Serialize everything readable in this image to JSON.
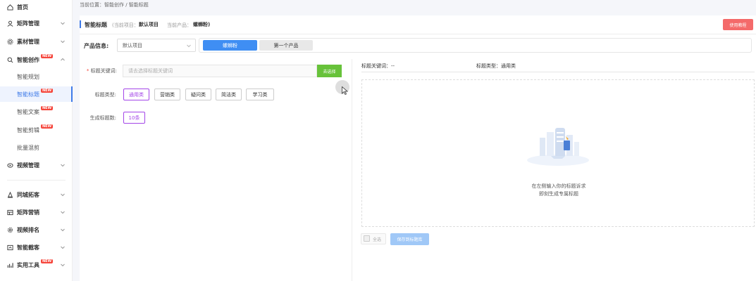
{
  "sidebar": {
    "items": [
      {
        "label": "首页",
        "icon": "home-icon"
      },
      {
        "label": "矩阵管理",
        "icon": "user-icon"
      },
      {
        "label": "素材管理",
        "icon": "gear-icon"
      },
      {
        "label": "智能创作",
        "icon": "search-icon",
        "badge": "NEW"
      },
      {
        "label": "视频管理",
        "icon": "video-icon"
      },
      {
        "label": "同城拓客",
        "icon": "person-icon"
      },
      {
        "label": "矩阵营销",
        "icon": "grid-icon"
      },
      {
        "label": "视频排名",
        "icon": "gear-small-icon"
      },
      {
        "label": "智能截客",
        "icon": "capture-icon"
      },
      {
        "label": "实用工具",
        "icon": "chart-icon",
        "badge": "NEW"
      }
    ],
    "sub_items": [
      {
        "label": "智能规划"
      },
      {
        "label": "智能标题",
        "badge": "NEW"
      },
      {
        "label": "智能文案",
        "badge": "NEW"
      },
      {
        "label": "智能剪辑",
        "badge": "NEW"
      },
      {
        "label": "批量混剪"
      }
    ]
  },
  "breadcrumb": "当前位置：智能创作 / 智能标题",
  "header": {
    "title": "智能标题",
    "project_label": "(当前项目：",
    "project_value": "默认项目",
    "product_label": "当前产品：",
    "product_value": "螺蛳粉)",
    "tutorial_button": "使用教程"
  },
  "product_info": {
    "label": "产品信息:",
    "project_select": "默认项目",
    "tabs": [
      "螺蛳粉",
      "第一个产品"
    ]
  },
  "form": {
    "keyword_label": "标题关键词:",
    "keyword_required": "*",
    "keyword_placeholder": "请去选择标题关键词",
    "keyword_button": "去选择",
    "type_label": "标题类型:",
    "types": [
      "通用类",
      "营销类",
      "疑问类",
      "简洁类",
      "学习类"
    ],
    "count_label": "生成标题数:",
    "count_value": "10条"
  },
  "result": {
    "keyword_info": "标题关键词：--",
    "type_info": "标题类型：通用类",
    "empty_line1": "在左侧输入你的标题诉求",
    "empty_line2": "即刻生成专属标题",
    "select_all": "全选",
    "save_button": "保存到标题库"
  },
  "colors": {
    "primary": "#3f8ef3",
    "accent_purple": "#a345e8",
    "green": "#67c23a",
    "red": "#f46a6a"
  }
}
